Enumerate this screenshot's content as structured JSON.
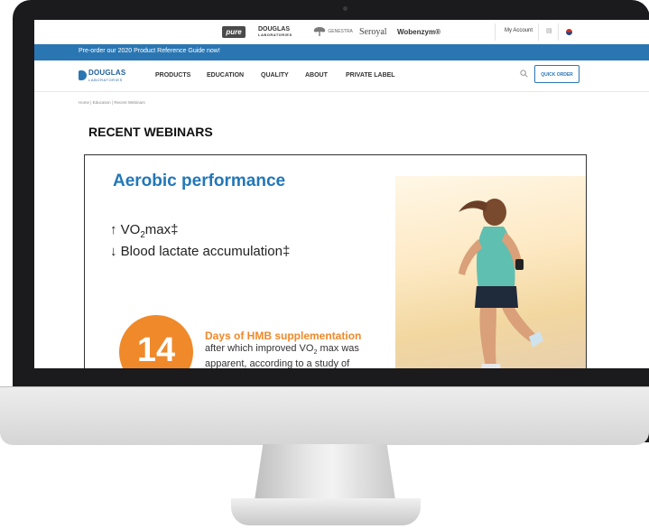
{
  "brands": {
    "pure": "pure",
    "douglas": "DOUGLAS",
    "douglas_sub": "LABORATORIES",
    "genestra": "GENESTRA",
    "seroyal": "Seroyal",
    "wobenzym": "Wobenzym®"
  },
  "top_bar": {
    "my_account": "My Account"
  },
  "promo": {
    "text": "Pre-order our 2020 Product Reference Guide now!"
  },
  "logo": {
    "word": "DOUGLAS",
    "sub": "LABORATORIES"
  },
  "nav": {
    "items": [
      "PRODUCTS",
      "EDUCATION",
      "QUALITY",
      "ABOUT",
      "PRIVATE LABEL"
    ],
    "quick_order": "QUICK ORDER"
  },
  "breadcrumb": "Home | Education | Recent Webinars",
  "page_title": "RECENT WEBINARS",
  "slide": {
    "title": "Aerobic performance",
    "line1_prefix": "↑ VO",
    "line1_sub": "2",
    "line1_suffix": "max‡",
    "line2": "↓ Blood lactate accumulation‡",
    "stat_number": "14",
    "stat_heading": "Days of HMB supplementation",
    "stat_desc_prefix": "after which improved VO",
    "stat_desc_sub": "2",
    "stat_desc_suffix": " max was apparent, according to a study of"
  },
  "colors": {
    "brand_blue": "#2a76b3",
    "slide_title_blue": "#2277b8",
    "accent_orange": "#f0892a"
  }
}
